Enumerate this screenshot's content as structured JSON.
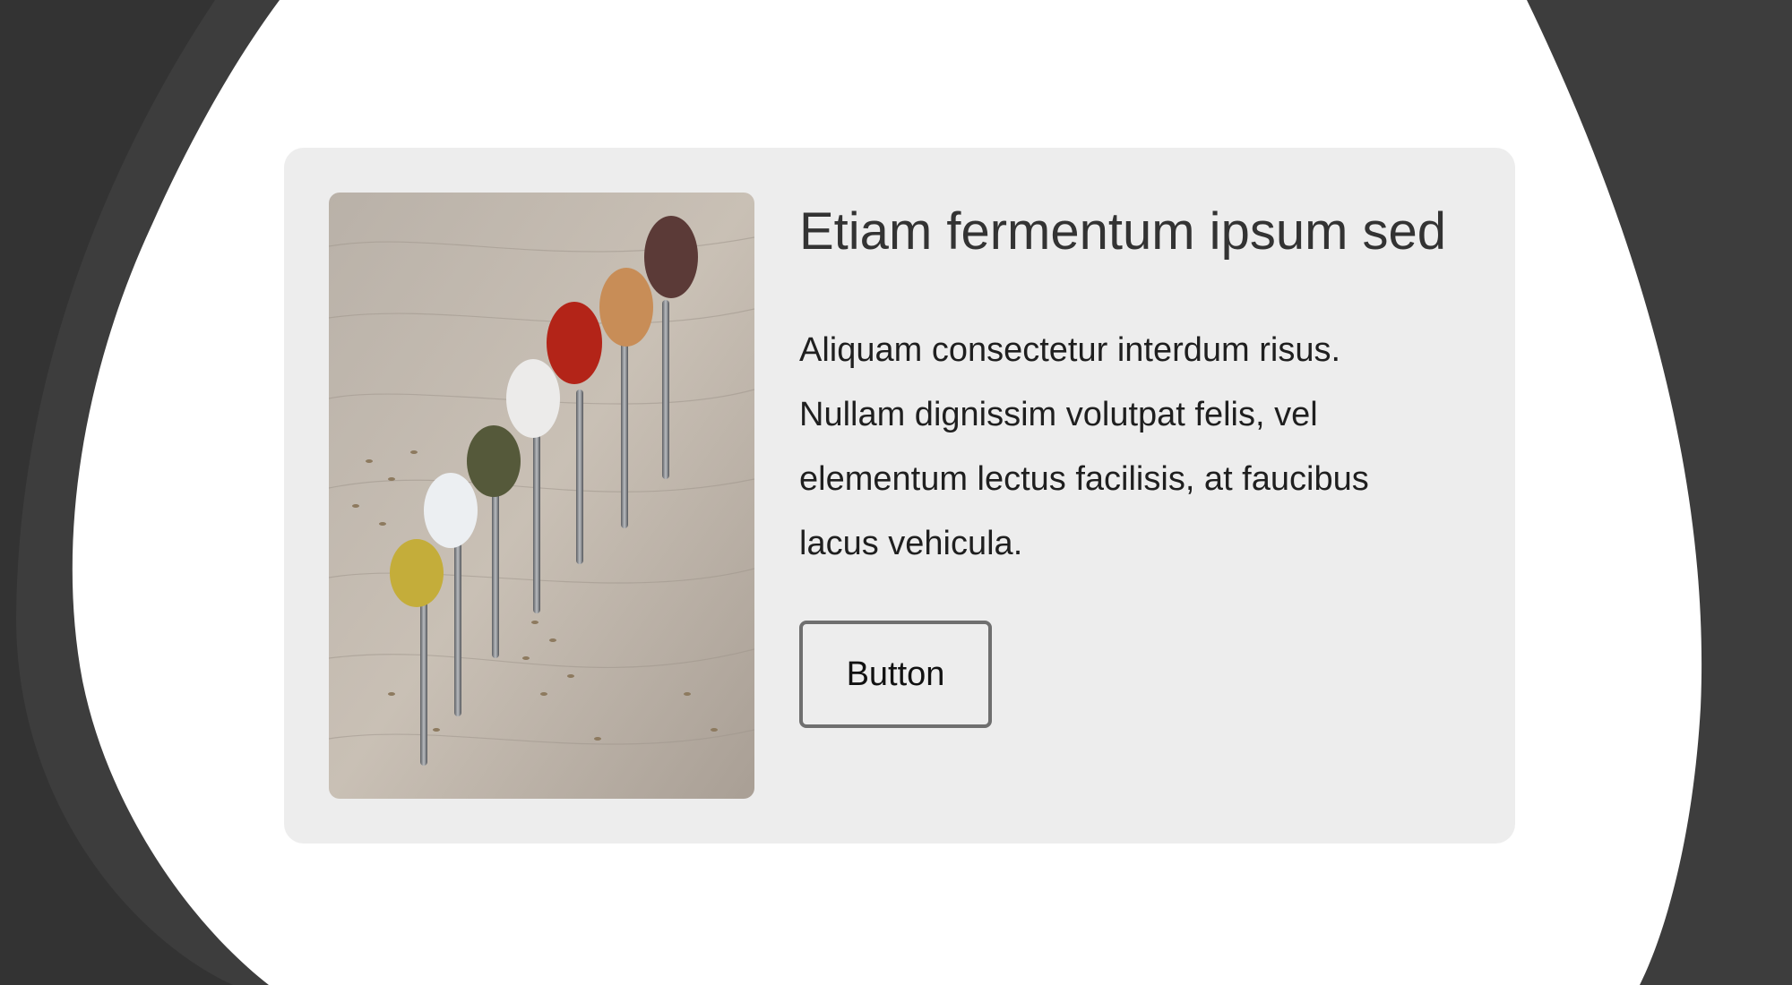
{
  "colors": {
    "page_background": "#3a3a3a",
    "blob": "#ffffff",
    "card_background": "#ededed",
    "title": "#333333",
    "text": "#1f1f1f",
    "button_border": "#6f6f6f"
  },
  "card": {
    "image_icon": "spice-spoons-photo",
    "title": "Etiam fermentum ipsum sed",
    "body": "Aliquam consectetur interdum risus. Nullam dignissim volutpat felis, vel elementum lectus facilisis, at faucibus lacus vehicula.",
    "button_label": "Button"
  }
}
